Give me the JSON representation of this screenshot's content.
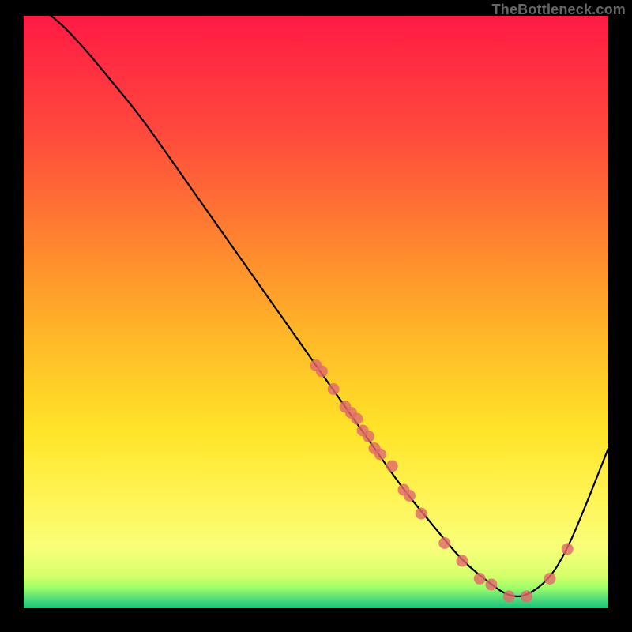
{
  "watermark": "TheBottleneck.com",
  "chart_data": {
    "type": "line",
    "title": "",
    "xlabel": "",
    "ylabel": "",
    "xlim": [
      0,
      100
    ],
    "ylim": [
      0,
      100
    ],
    "curve": {
      "x": [
        0,
        5,
        10,
        15,
        20,
        25,
        30,
        35,
        40,
        45,
        50,
        55,
        60,
        65,
        70,
        75,
        80,
        83,
        86,
        90,
        93,
        96,
        100
      ],
      "y": [
        103,
        100,
        95,
        89,
        83,
        76,
        69,
        62,
        55,
        48,
        41,
        34,
        27,
        20,
        14,
        8,
        4,
        2,
        2,
        5,
        10,
        17,
        27
      ]
    },
    "markers": {
      "x": [
        50,
        51,
        53,
        55,
        56,
        57,
        58,
        59,
        60,
        61,
        63,
        65,
        66,
        68,
        72,
        75,
        78,
        80,
        83,
        86,
        90,
        93
      ],
      "y": [
        41,
        40,
        37,
        34,
        33,
        32,
        30,
        29,
        27,
        26,
        24,
        20,
        19,
        16,
        11,
        8,
        5,
        4,
        2,
        2,
        5,
        10
      ]
    },
    "gradient_stops": [
      {
        "offset": 0.0,
        "color": "#ff1a44"
      },
      {
        "offset": 0.2,
        "color": "#ff4a3d"
      },
      {
        "offset": 0.4,
        "color": "#ff8a2e"
      },
      {
        "offset": 0.55,
        "color": "#ffba28"
      },
      {
        "offset": 0.7,
        "color": "#ffe428"
      },
      {
        "offset": 0.82,
        "color": "#fff558"
      },
      {
        "offset": 0.9,
        "color": "#f8ff7a"
      },
      {
        "offset": 0.945,
        "color": "#d6ff6a"
      },
      {
        "offset": 0.965,
        "color": "#9fff68"
      },
      {
        "offset": 0.985,
        "color": "#4fd97a"
      },
      {
        "offset": 1.0,
        "color": "#18c47a"
      }
    ]
  }
}
